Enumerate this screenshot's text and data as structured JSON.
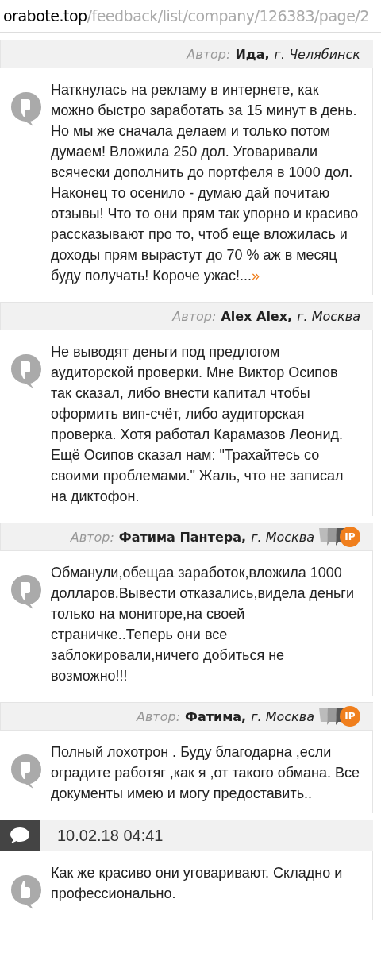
{
  "address_bar": {
    "domain": "orabote.top",
    "path": "/feedback/list/company/126383/page/2"
  },
  "reviews": [
    {
      "kind": "author",
      "label": "Автор:",
      "name": "Ида,",
      "city": "г. Челябинск",
      "negative": true,
      "text": "Наткнулась на рекламу в интернете, как можно быстро заработать за 15 минут в день. Но мы же сначала делаем и только потом думаем! Вложила 250 дол. Уговаривали всячески дополнить до портфеля в 1000 дол. Наконец то осенило - думаю дай почитаю отзывы! Что то они прям так упорно и красиво рассказывают про то, чтоб еще вложилась и доходы прям вырастут до 70 % аж в месяц буду получать! Короче ужас!...",
      "more": "»"
    },
    {
      "kind": "author",
      "label": "Автор:",
      "name": "Alex Alex,",
      "city": "г. Москва",
      "negative": true,
      "text": "Не выводят деньги под предлогом аудиторской проверки. Мне Виктор Осипов так сказал, либо внести капитал чтобы оформить вип-счёт, либо аудиторская проверка. Хотя работал Карамазов Леонид. Ещё Осипов сказал нам: \"Трахайтесь со своими проблемами.\" Жаль, что не записал на диктофон."
    },
    {
      "kind": "author",
      "label": "Автор:",
      "name": "Фатима Пантера,",
      "city": "г. Москва",
      "badge": "IP",
      "negative": true,
      "text": "Обманули,обещаа заработок,вложила 1000 долларов.Вывести отказались,видела деньги только на мониторе,на своей страничке..Теперь они все заблокировали,ничего добиться не возможно!!!"
    },
    {
      "kind": "author",
      "label": "Автор:",
      "name": "Фатима,",
      "city": "г. Москва",
      "badge": "IP",
      "negative": true,
      "text": "Полный лохотрон . Буду благодарна ,если оградите работяг ,как я ,от такого обмана. Все документы имею и могу предоставить.."
    },
    {
      "kind": "date",
      "date": "10.02.18 04:41",
      "negative": false,
      "text": "Как же красиво они уговаривают. Складно и профессионально."
    }
  ]
}
